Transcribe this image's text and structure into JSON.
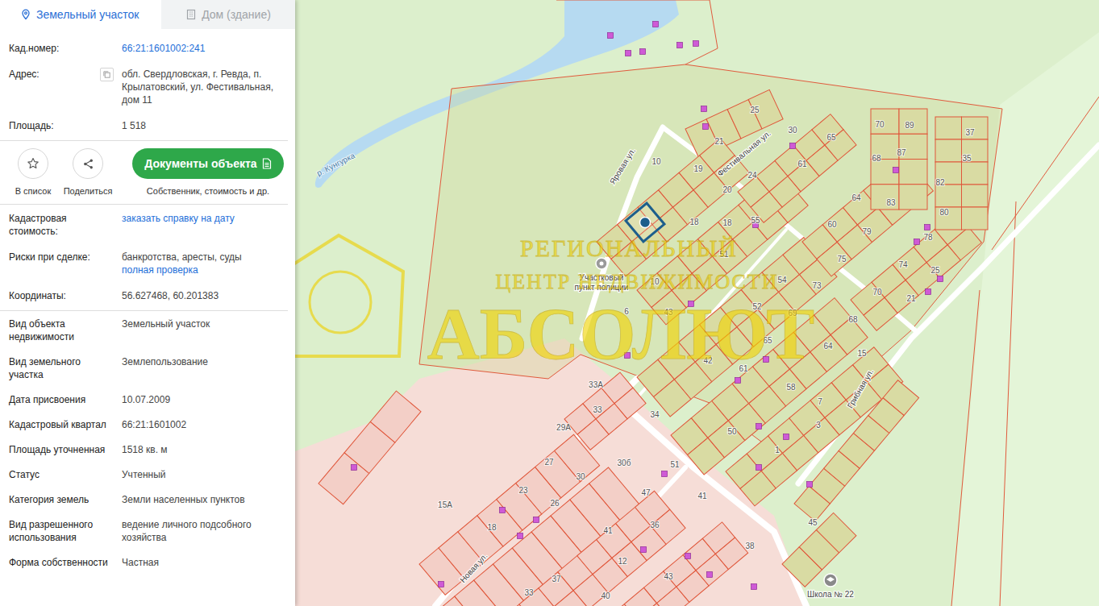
{
  "tabs": [
    {
      "label": "Земельный участок",
      "selected": true
    },
    {
      "label": "Дом (здание)",
      "selected": false
    }
  ],
  "summary": [
    {
      "label": "Кад.номер:",
      "kind": "plain",
      "parts": [
        {
          "text": "66:21:1601002:241",
          "kind": "link"
        }
      ]
    },
    {
      "label": "Адрес:",
      "kind": "copyable",
      "parts": [
        {
          "text": "обл. Свердловская, г. Ревда, п. Крылатовский, ул. Фестивальная, дом 11",
          "kind": "text"
        }
      ]
    },
    {
      "label": "Площадь:",
      "kind": "plain",
      "parts": [
        {
          "text": "1 518",
          "kind": "text"
        }
      ]
    }
  ],
  "actions": {
    "favorite": {
      "label": "В список"
    },
    "share": {
      "label": "Поделиться"
    },
    "documents": {
      "label": "Документы объекта",
      "caption": "Собственник, стоимость и др."
    }
  },
  "info": [
    {
      "label": "Кадастровая стоимость:",
      "kind": "plain",
      "parts": [
        {
          "text": "заказать справку на дату",
          "kind": "link"
        }
      ]
    },
    {
      "label": "Риски при сделке:",
      "kind": "plain",
      "parts": [
        {
          "text": "банкротства, аресты, суды",
          "kind": "text"
        },
        {
          "text": "полная проверка",
          "kind": "link"
        }
      ]
    },
    {
      "label": "Координаты:",
      "kind": "plain",
      "parts": [
        {
          "text": "56.627468, 60.201383",
          "kind": "text"
        }
      ]
    }
  ],
  "details": [
    {
      "label": "Вид объекта недвижимости",
      "kind": "plain",
      "parts": [
        {
          "text": "Земельный участок",
          "kind": "text"
        }
      ]
    },
    {
      "label": "Вид земельного участка",
      "kind": "plain",
      "parts": [
        {
          "text": "Землепользование",
          "kind": "text"
        }
      ]
    },
    {
      "label": "Дата присвоения",
      "kind": "plain",
      "parts": [
        {
          "text": "10.07.2009",
          "kind": "text"
        }
      ]
    },
    {
      "label": "Кадастровый квартал",
      "kind": "plain",
      "parts": [
        {
          "text": "66:21:1601002",
          "kind": "text"
        }
      ]
    },
    {
      "label": "Площадь уточненная",
      "kind": "plain",
      "parts": [
        {
          "text": "1518 кв. м",
          "kind": "text"
        }
      ]
    },
    {
      "label": "Статус",
      "kind": "plain",
      "parts": [
        {
          "text": "Учтенный",
          "kind": "text"
        }
      ]
    },
    {
      "label": "Категория земель",
      "kind": "plain",
      "parts": [
        {
          "text": "Земли населенных пунктов",
          "kind": "text"
        }
      ]
    },
    {
      "label": "Вид разрешенного использования",
      "kind": "plain",
      "parts": [
        {
          "text": "ведение личного подсобного хозяйства",
          "kind": "text"
        }
      ]
    },
    {
      "label": "Форма собственности",
      "kind": "plain",
      "parts": [
        {
          "text": "Частная",
          "kind": "text"
        }
      ]
    }
  ],
  "map": {
    "river": "р. Кунгурка",
    "streets": [
      {
        "name": "Яровая ул."
      },
      {
        "name": "Фестивальная ул."
      },
      {
        "name": "Грибная ул."
      },
      {
        "name": "Новая ул."
      }
    ],
    "pois": [
      {
        "lines": [
          "Участковый",
          "пункт полиции"
        ]
      },
      {
        "lines": [
          "Школа № 22"
        ]
      }
    ],
    "parcel_numbers": [
      "25",
      "21",
      "19",
      "10",
      "24",
      "20",
      "30",
      "65",
      "61",
      "70",
      "89",
      "68",
      "87",
      "37",
      "35",
      "82",
      "80",
      "64",
      "83",
      "60",
      "79",
      "78",
      "75",
      "74",
      "25",
      "70",
      "21",
      "18",
      "18",
      "55",
      "51",
      "10",
      "54",
      "73",
      "43",
      "6",
      "52",
      "69",
      "68",
      "65",
      "64",
      "15",
      "42",
      "61",
      "58",
      "7",
      "3",
      "34",
      "50",
      "1",
      "45",
      "33А",
      "33",
      "29А",
      "27",
      "30б",
      "51",
      "23",
      "30",
      "47",
      "41",
      "15А",
      "26",
      "18",
      "41",
      "36",
      "38",
      "12",
      "37",
      "33",
      "43",
      "40"
    ],
    "watermark": [
      "РЕГИОНАЛЬНЫЙ",
      "ЦЕНТР НЕДВИЖИМОСТИ",
      "АБСОЛЮТ"
    ]
  }
}
